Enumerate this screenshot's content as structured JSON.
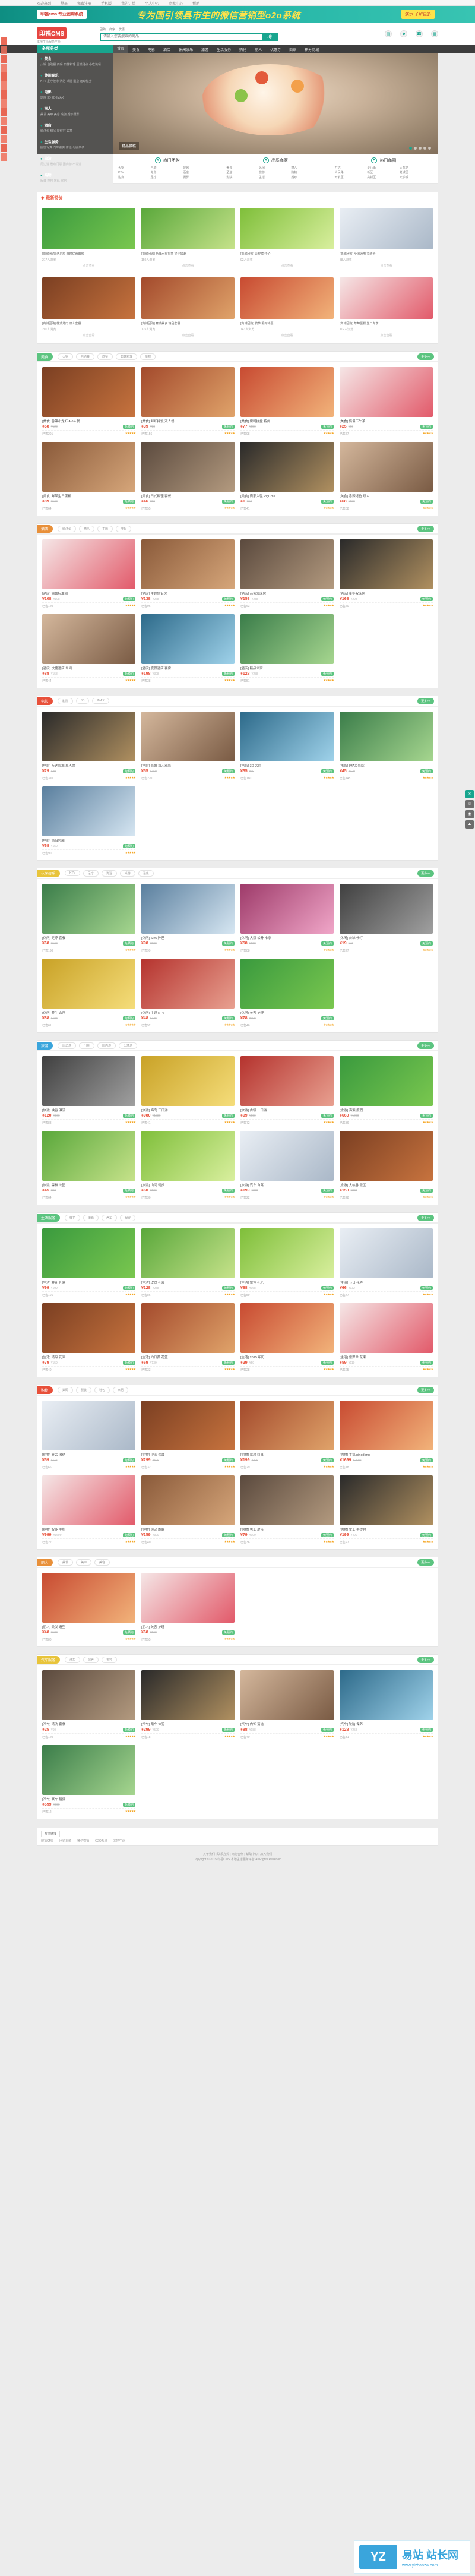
{
  "topbar": {
    "items": [
      "欢迎来到",
      "登录",
      "免费注册",
      "手机版",
      "我的订单",
      "个人中心",
      "商家中心",
      "帮助"
    ]
  },
  "banner": {
    "left": "印福cms 专业团购系统",
    "title": "专为国引领县市生的微信营销型o2o系统",
    "right": "演示 了解更多"
  },
  "header": {
    "logo": "印福CMS",
    "logo_sub": "本地生活服务平台",
    "search_tabs": [
      "团购",
      "商家",
      "优惠"
    ],
    "search_placeholder": "请输入您要搜索的商品",
    "search_btn": "搜"
  },
  "nav": {
    "category": "全部分类",
    "items": [
      "首页",
      "美食",
      "电影",
      "酒店",
      "休闲娱乐",
      "旅游",
      "生活服务",
      "购物",
      "丽人",
      "优惠券",
      "商家",
      "积分商城"
    ]
  },
  "catmenu": [
    {
      "title": "美食",
      "subs": "火锅 自助餐 西餐 日韩料理 蛋糕甜点 小吃快餐"
    },
    {
      "title": "休闲娱乐",
      "subs": "KTV 足疗按摩 洗浴 桌游 温泉 运动健身"
    },
    {
      "title": "电影",
      "subs": "影院 3D 2D IMAX"
    },
    {
      "title": "丽人",
      "subs": "美发 美甲 美容 瑜伽 婚纱摄影"
    },
    {
      "title": "酒店",
      "subs": "经济型 精品 度假村 公寓"
    },
    {
      "title": "生活服务",
      "subs": "摄影写真 汽车服务 体检 母婴亲子"
    },
    {
      "title": "旅游",
      "subs": "周边游 景点门票 国内游 出境游"
    },
    {
      "title": "购物",
      "subs": "服装 鞋包 数码 家居"
    }
  ],
  "slide": {
    "caption": "精品蛋糕",
    "dots": 5
  },
  "tri": [
    {
      "title": "热门团购",
      "links": [
        "火锅",
        "自助",
        "烧烤",
        "KTV",
        "电影",
        "酒店",
        "甜点",
        "足疗",
        "摄影"
      ]
    },
    {
      "title": "品质商家",
      "links": [
        "美食",
        "休闲",
        "丽人",
        "酒店",
        "旅游",
        "购物",
        "影院",
        "生活",
        "婚纱"
      ]
    },
    {
      "title": "热门商圈",
      "links": [
        "万达",
        "步行街",
        "火车站",
        "人民路",
        "新区",
        "老城区",
        "开发区",
        "高新区",
        "大学城"
      ]
    }
  ],
  "rec": {
    "title": "最新特价",
    "items": [
      {
        "cap": "[商城团购] 老乡鸡 限时优惠套餐",
        "views": "217人浏览",
        "more": "点击查看"
      },
      {
        "cap": "[商城团购] 新鲜水果礼盒 好评如潮",
        "views": "150人浏览",
        "more": "点击查看"
      },
      {
        "cap": "[商城团购] 青柠檬 特价",
        "views": "92人浏览",
        "more": "点击查看"
      },
      {
        "cap": "[商城团购] 全国通用 充值卡",
        "views": "88人浏览",
        "more": "点击查看"
      },
      {
        "cap": "[商城团购] 韩式烤肉 双人套餐",
        "views": "201人浏览",
        "more": "点击查看"
      },
      {
        "cap": "[商城团购] 意式美食 精品套餐",
        "views": "175人浏览",
        "more": "点击查看"
      },
      {
        "cap": "[商城团购] 披萨 限时特惠",
        "views": "143人浏览",
        "more": "点击查看"
      },
      {
        "cap": "[商城团购] 草莓蛋糕 生日专享",
        "views": "112人浏览",
        "more": "点击查看"
      }
    ]
  },
  "sections": [
    {
      "tag": "美食",
      "subs": [
        "火锅",
        "自助餐",
        "西餐",
        "日韩料理",
        "蛋糕"
      ],
      "more": "更多>>",
      "items": [
        {
          "t": "[美食] 香辣小龙虾 4-6人餐",
          "now": "¥58",
          "old": "¥128",
          "tag": "免预约",
          "sold": "已售201",
          "st": "★★★★★"
        },
        {
          "t": "[美食] 鲜虾拌饭 双人餐",
          "now": "¥39",
          "old": "¥88",
          "tag": "免预约",
          "sold": "已售156",
          "st": "★★★★★"
        },
        {
          "t": "[美食] 烤鸭拼盘 特价",
          "now": "¥77",
          "old": "¥150",
          "tag": "免预约",
          "sold": "已售98",
          "st": "★★★★★"
        },
        {
          "t": "[美食] 情侣下午茶",
          "now": "¥25",
          "old": "¥60",
          "tag": "免预约",
          "sold": "已售77",
          "st": "★★★★★"
        },
        {
          "t": "[美食] 鲜果生日蛋糕",
          "now": "¥89",
          "old": "¥168",
          "tag": "免预约",
          "sold": "已售64",
          "st": "★★★★★"
        },
        {
          "t": "[美食] 日式料理 套餐",
          "now": "¥46",
          "old": "¥99",
          "tag": "免预约",
          "sold": "已售55",
          "st": "★★★★★"
        },
        {
          "t": "[美食] 商家入驻 PigCms",
          "now": "¥1",
          "old": "¥10",
          "tag": "免预约",
          "sold": "已售41",
          "st": "★★★★★"
        },
        {
          "t": "[美食] 香辣烤鱼 双人",
          "now": "¥68",
          "old": "¥138",
          "tag": "免预约",
          "sold": "已售88",
          "st": "★★★★★"
        }
      ]
    },
    {
      "tag": "酒店",
      "subs": [
        "经济型",
        "精品",
        "主题",
        "度假"
      ],
      "more": "更多>>",
      "items": [
        {
          "t": "[酒店] 温馨标准间",
          "now": "¥108",
          "old": "¥198",
          "tag": "免预约",
          "sold": "已售120",
          "st": "★★★★★"
        },
        {
          "t": "[酒店] 主题情侣房",
          "now": "¥138",
          "old": "¥268",
          "tag": "免预约",
          "sold": "已售96",
          "st": "★★★★★"
        },
        {
          "t": "[酒店] 商务大床房",
          "now": "¥158",
          "old": "¥288",
          "tag": "免预约",
          "sold": "已售63",
          "st": "★★★★★"
        },
        {
          "t": "[酒店] 豪华双床房",
          "now": "¥168",
          "old": "¥298",
          "tag": "免预约",
          "sold": "已售70",
          "st": "★★★★★"
        },
        {
          "t": "[酒店] 快捷酒店 单间",
          "now": "¥88",
          "old": "¥158",
          "tag": "免预约",
          "sold": "已售44",
          "st": "★★★★★"
        },
        {
          "t": "[酒店] 度假酒店 套房",
          "now": "¥198",
          "old": "¥398",
          "tag": "免预约",
          "sold": "已售38",
          "st": "★★★★★"
        },
        {
          "t": "[酒店] 精品公寓",
          "now": "¥128",
          "old": "¥238",
          "tag": "免预约",
          "sold": "已售51",
          "st": "★★★★★"
        }
      ]
    },
    {
      "tag": "电影",
      "subs": [
        "影院",
        "3D",
        "IMAX"
      ],
      "more": "更多>>",
      "items": [
        {
          "t": "[电影] 万达影城 单人票",
          "now": "¥29",
          "old": "¥80",
          "tag": "免预约",
          "sold": "已售310",
          "st": "★★★★★"
        },
        {
          "t": "[电影] 影城 双人观影",
          "now": "¥55",
          "old": "¥160",
          "tag": "免预约",
          "sold": "已售220",
          "st": "★★★★★"
        },
        {
          "t": "[电影] 3D 大厅",
          "now": "¥35",
          "old": "¥90",
          "tag": "免预约",
          "sold": "已售180",
          "st": "★★★★★"
        },
        {
          "t": "[电影] IMAX 影院",
          "now": "¥45",
          "old": "¥120",
          "tag": "免预约",
          "sold": "已售145",
          "st": "★★★★★"
        },
        {
          "t": "[电影] 情侣包厢",
          "now": "¥68",
          "old": "¥150",
          "tag": "免预约",
          "sold": "已售90",
          "st": "★★★★★"
        }
      ]
    },
    {
      "tag": "休闲娱乐",
      "subs": [
        "KTV",
        "足疗",
        "洗浴",
        "桌游",
        "温泉"
      ],
      "more": "更多>>",
      "items": [
        {
          "t": "[休闲] 足疗 套餐",
          "now": "¥68",
          "old": "¥168",
          "tag": "免预约",
          "sold": "已售130",
          "st": "★★★★★"
        },
        {
          "t": "[休闲] SPA 护理",
          "now": "¥98",
          "old": "¥228",
          "tag": "免预约",
          "sold": "已售99",
          "st": "★★★★★"
        },
        {
          "t": "[休闲] 大汉 松骨 推拿",
          "now": "¥58",
          "old": "¥128",
          "tag": "免预约",
          "sold": "已售88",
          "st": "★★★★★"
        },
        {
          "t": "[休闲] 台球 畅打",
          "now": "¥19",
          "old": "¥40",
          "tag": "免预约",
          "sold": "已售77",
          "st": "★★★★★"
        },
        {
          "t": "[休闲] 养生 会所",
          "now": "¥88",
          "old": "¥188",
          "tag": "免预约",
          "sold": "已售61",
          "st": "★★★★★"
        },
        {
          "t": "[休闲] 主题 KTV",
          "now": "¥48",
          "old": "¥128",
          "tag": "免预约",
          "sold": "已售52",
          "st": "★★★★★"
        },
        {
          "t": "[休闲] 美容 护理",
          "now": "¥78",
          "old": "¥198",
          "tag": "免预约",
          "sold": "已售46",
          "st": "★★★★★"
        }
      ]
    },
    {
      "tag": "旅游",
      "subs": [
        "周边游",
        "门票",
        "国内游",
        "出境游"
      ],
      "more": "更多>>",
      "items": [
        {
          "t": "[旅游] 峡谷 漂流",
          "now": "¥120",
          "old": "¥260",
          "tag": "免预约",
          "sold": "已售88",
          "st": "★★★★★"
        },
        {
          "t": "[旅游] 海岛 三日游",
          "now": "¥980",
          "old": "¥1880",
          "tag": "免预约",
          "sold": "已售41",
          "st": "★★★★★"
        },
        {
          "t": "[旅游] 古镇 一日游",
          "now": "¥99",
          "old": "¥199",
          "tag": "免预约",
          "sold": "已售72",
          "st": "★★★★★"
        },
        {
          "t": "[旅游] 海滨 度假",
          "now": "¥660",
          "old": "¥1280",
          "tag": "免预约",
          "sold": "已售36",
          "st": "★★★★★"
        },
        {
          "t": "[旅游] 森林 公园",
          "now": "¥45",
          "old": "¥90",
          "tag": "免预约",
          "sold": "已售64",
          "st": "★★★★★"
        },
        {
          "t": "[旅游] 山间 徒步",
          "now": "¥60",
          "old": "¥120",
          "tag": "免预约",
          "sold": "已售30",
          "st": "★★★★★"
        },
        {
          "t": "[旅游] 汽车 自驾",
          "now": "¥199",
          "old": "¥399",
          "tag": "免预约",
          "sold": "已售22",
          "st": "★★★★★"
        },
        {
          "t": "[旅游] 大峡谷 景区",
          "now": "¥150",
          "old": "¥300",
          "tag": "免预约",
          "sold": "已售28",
          "st": "★★★★★"
        }
      ]
    },
    {
      "tag": "生活服务",
      "subs": [
        "鲜花",
        "摄影",
        "汽车",
        "母婴"
      ],
      "more": "更多>>",
      "items": [
        {
          "t": "[生活] 鲜花 礼盒",
          "now": "¥99",
          "old": "¥199",
          "tag": "免预约",
          "sold": "已售101",
          "st": "★★★★★"
        },
        {
          "t": "[生活] 玫瑰 花束",
          "now": "¥128",
          "old": "¥258",
          "tag": "免预约",
          "sold": "已售86",
          "st": "★★★★★"
        },
        {
          "t": "[生活] 紫色 花艺",
          "now": "¥88",
          "old": "¥168",
          "tag": "免预约",
          "sold": "已售59",
          "st": "★★★★★"
        },
        {
          "t": "[生活] 节日 花卉",
          "now": "¥66",
          "old": "¥132",
          "tag": "免预约",
          "sold": "已售47",
          "st": "★★★★★"
        },
        {
          "t": "[生活] 精品 花束",
          "now": "¥79",
          "old": "¥159",
          "tag": "免预约",
          "sold": "已售40",
          "st": "★★★★★"
        },
        {
          "t": "[生活] 向日葵 花篮",
          "now": "¥69",
          "old": "¥139",
          "tag": "免预约",
          "sold": "已售33",
          "st": "★★★★★"
        },
        {
          "t": "[生活] 2015 年历",
          "now": "¥29",
          "old": "¥59",
          "tag": "免预约",
          "sold": "已售28",
          "st": "★★★★★"
        },
        {
          "t": "[生活] 紫罗兰 花束",
          "now": "¥59",
          "old": "¥119",
          "tag": "免预约",
          "sold": "已售25",
          "st": "★★★★★"
        }
      ]
    },
    {
      "tag": "购物",
      "subs": [
        "数码",
        "服装",
        "鞋包",
        "家居"
      ],
      "more": "更多>>",
      "items": [
        {
          "t": "[购物] 复古 收纳",
          "now": "¥59",
          "old": "¥119",
          "tag": "免预约",
          "sold": "已售66",
          "st": "★★★★★"
        },
        {
          "t": "[购物] 卫浴 套装",
          "now": "¥299",
          "old": "¥599",
          "tag": "免预约",
          "sold": "已售32",
          "st": "★★★★★"
        },
        {
          "t": "[购物] 家居 灯具",
          "now": "¥199",
          "old": "¥399",
          "tag": "免预约",
          "sold": "已售29",
          "st": "★★★★★"
        },
        {
          "t": "[购物] 手机 pingdong",
          "now": "¥1699",
          "old": "¥2599",
          "tag": "免预约",
          "sold": "已售18",
          "st": "★★★★★"
        },
        {
          "t": "[购物] 智能 手机",
          "now": "¥999",
          "old": "¥1699",
          "tag": "免预约",
          "sold": "已售22",
          "st": "★★★★★"
        },
        {
          "t": "[购物] 运动 跑鞋",
          "now": "¥159",
          "old": "¥399",
          "tag": "免预约",
          "sold": "已售40",
          "st": "★★★★★"
        },
        {
          "t": "[购物] 男士 皮带",
          "now": "¥79",
          "old": "¥199",
          "tag": "免预约",
          "sold": "已售36",
          "st": "★★★★★"
        },
        {
          "t": "[购物] 女士 手提包",
          "now": "¥199",
          "old": "¥499",
          "tag": "免预约",
          "sold": "已售27",
          "st": "★★★★★"
        }
      ]
    },
    {
      "tag": "丽人",
      "subs": [
        "美发",
        "美甲",
        "美容"
      ],
      "more": "更多>>",
      "items": [
        {
          "t": "[丽人] 美发 造型",
          "now": "¥48",
          "old": "¥128",
          "tag": "免预约",
          "sold": "已售80",
          "st": "★★★★★"
        },
        {
          "t": "[丽人] 美容 护理",
          "now": "¥68",
          "old": "¥168",
          "tag": "免预约",
          "sold": "已售55",
          "st": "★★★★★"
        }
      ]
    },
    {
      "tag": "汽车服务",
      "subs": [
        "洗车",
        "保养",
        "美容"
      ],
      "more": "更多>>",
      "items": [
        {
          "t": "[汽车] 精洗 套餐",
          "now": "¥25",
          "old": "¥60",
          "tag": "免预约",
          "sold": "已售120",
          "st": "★★★★★"
        },
        {
          "t": "[汽车] 跑车 体验",
          "now": "¥299",
          "old": "¥599",
          "tag": "免预约",
          "sold": "已售18",
          "st": "★★★★★"
        },
        {
          "t": "[汽车] 内饰 清洁",
          "now": "¥88",
          "old": "¥188",
          "tag": "免预约",
          "sold": "已售40",
          "st": "★★★★★"
        },
        {
          "t": "[汽车] 轮胎 保养",
          "now": "¥128",
          "old": "¥258",
          "tag": "免预约",
          "sold": "已售31",
          "st": "★★★★★"
        },
        {
          "t": "[汽车] 豪车 租赁",
          "now": "¥599",
          "old": "¥999",
          "tag": "免预约",
          "sold": "已售12",
          "st": "★★★★★"
        }
      ]
    }
  ],
  "footer": {
    "links_title": "友情链接",
    "links": [
      "印福CMS",
      "团购系统",
      "微信营销",
      "O2O系统",
      "本地生活"
    ],
    "copy1": "关于我们 | 联系方式 | 商务合作 | 帮助中心 | 加入我们",
    "copy2": "Copyright © 2015 印福CMS 本地生活服务平台 All Rights Reserved"
  },
  "watermark": {
    "logo": "YZ",
    "cn": "易站 站长网",
    "url": "www.yizhanzw.com"
  },
  "colors": {
    "accent": "#18a58e",
    "brand": "#e8503a"
  }
}
